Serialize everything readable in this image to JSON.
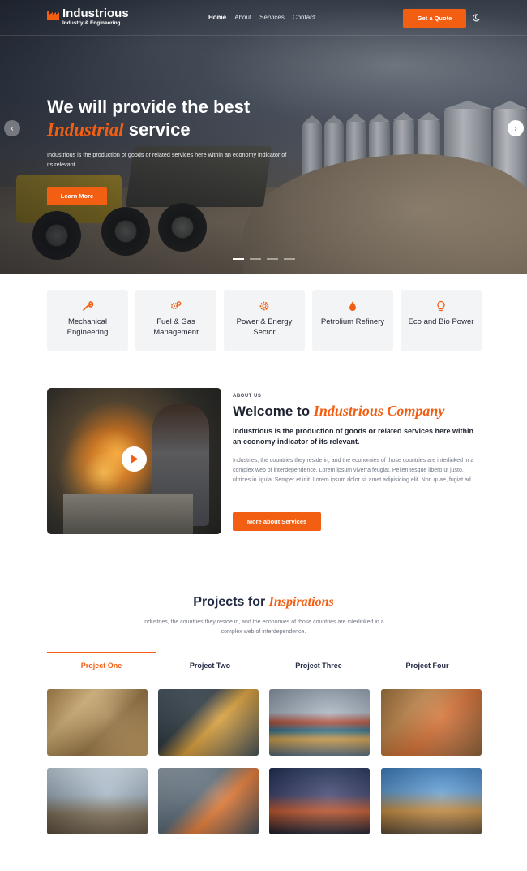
{
  "nav": {
    "brand": "Industrious",
    "tagline": "Industry & Engineering",
    "menu": [
      "Home",
      "About",
      "Services",
      "Contact"
    ],
    "active_menu": "Home",
    "cta": "Get a Quote"
  },
  "hero": {
    "title_line1": "We will provide the best",
    "title_accent": "Industrial",
    "title_end": "service",
    "text": "Industrious is the production of goods or related services here within an economy indicator of its relevant.",
    "button": "Learn More",
    "slide_count": 4,
    "active_slide": 1
  },
  "services": [
    {
      "label": "Mechanical Engineering",
      "icon": "wrench-icon"
    },
    {
      "label": "Fuel & Gas Management",
      "icon": "gears-icon"
    },
    {
      "label": "Power & Energy Sector",
      "icon": "sun-gear-icon"
    },
    {
      "label": "Petrolium Refinery",
      "icon": "oil-drop-icon"
    },
    {
      "label": "Eco and Bio Power",
      "icon": "lightbulb-icon"
    }
  ],
  "about": {
    "kicker": "ABOUT US",
    "title": "Welcome to",
    "title_accent": "Industrious Company",
    "lead": "Industrious is the production of goods or related services here within an economy indicator of its relevant.",
    "body": "Industries, the countries they reside in, and the economies of those countries are interlinked in a complex web of interdependence. Lorem ipsum viverra feugiat. Pellen tesque libero ut justo, ultrices in ligula. Semper et init. Lorem ipsum dolor sit amet adipisicing elit. Non quae, fugiat ad.",
    "button": "More about Services"
  },
  "projects": {
    "title": "Projects for",
    "title_accent": "Inspirations",
    "subtitle": "Industries, the countries they reside in, and the economies of those countries are interlinked in a complex web of interdependence.",
    "tabs": [
      "Project One",
      "Project Two",
      "Project Three",
      "Project Four"
    ],
    "active_tab": "Project One"
  },
  "colors": {
    "accent": "#f25e12",
    "dark": "#1e2330",
    "card_bg": "#f3f4f6"
  }
}
